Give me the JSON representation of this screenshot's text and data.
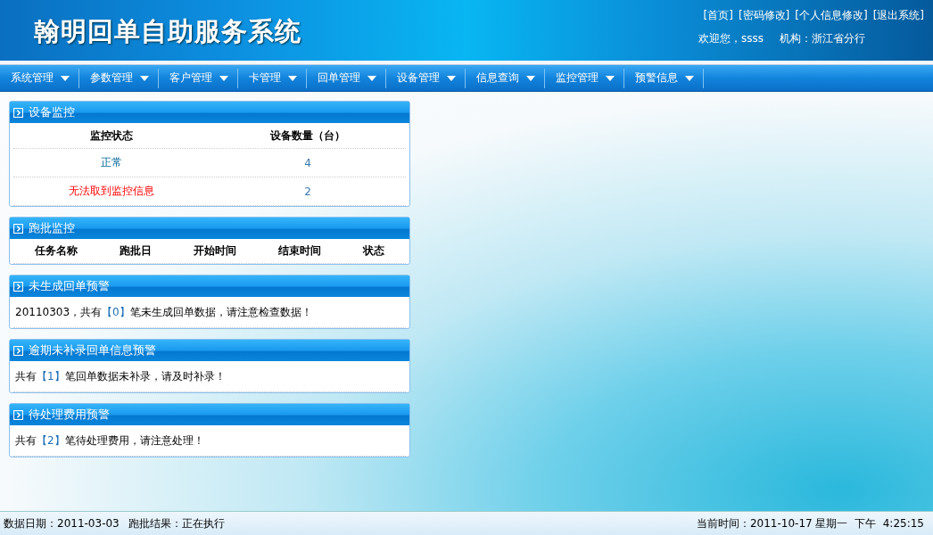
{
  "header": {
    "title": "翰明回单自助服务系统",
    "links": [
      "[首页]",
      "[密码修改]",
      "[个人信息修改]",
      "[退出系统]"
    ],
    "welcome": "欢迎您，ssss",
    "org": "机构：浙江省分行"
  },
  "menu": [
    "系统管理",
    "参数管理",
    "客户管理",
    "卡管理",
    "回单管理",
    "设备管理",
    "信息查询",
    "监控管理",
    "预警信息"
  ],
  "device_monitor": {
    "title": "设备监控",
    "columns": [
      "监控状态",
      "设备数量（台）"
    ],
    "rows": [
      {
        "status": "正常",
        "count": "4",
        "kind": "normal"
      },
      {
        "status": "无法取到监控信息",
        "count": "2",
        "kind": "error"
      }
    ]
  },
  "batch_monitor": {
    "title": "跑批监控",
    "columns": [
      "任务名称",
      "跑批日",
      "开始时间",
      "结束时间",
      "状态"
    ]
  },
  "alerts": [
    {
      "title": "未生成回单预警",
      "before": "20110303，共有",
      "count": "【0】",
      "after": "笔未生成回单数据，请注意检查数据！"
    },
    {
      "title": "逾期未补录回单信息预警",
      "before": "共有",
      "count": "【1】",
      "after": "笔回单数据未补录，请及时补录！"
    },
    {
      "title": "待处理费用预警",
      "before": "共有",
      "count": "【2】",
      "after": "笔待处理费用，请注意处理！"
    }
  ],
  "status_bar": {
    "left": [
      "数据日期：2011-03-03",
      "跑批结果：正在执行"
    ],
    "right": "当前时间：2011-10-17 星期一  下午  4:25:15"
  }
}
